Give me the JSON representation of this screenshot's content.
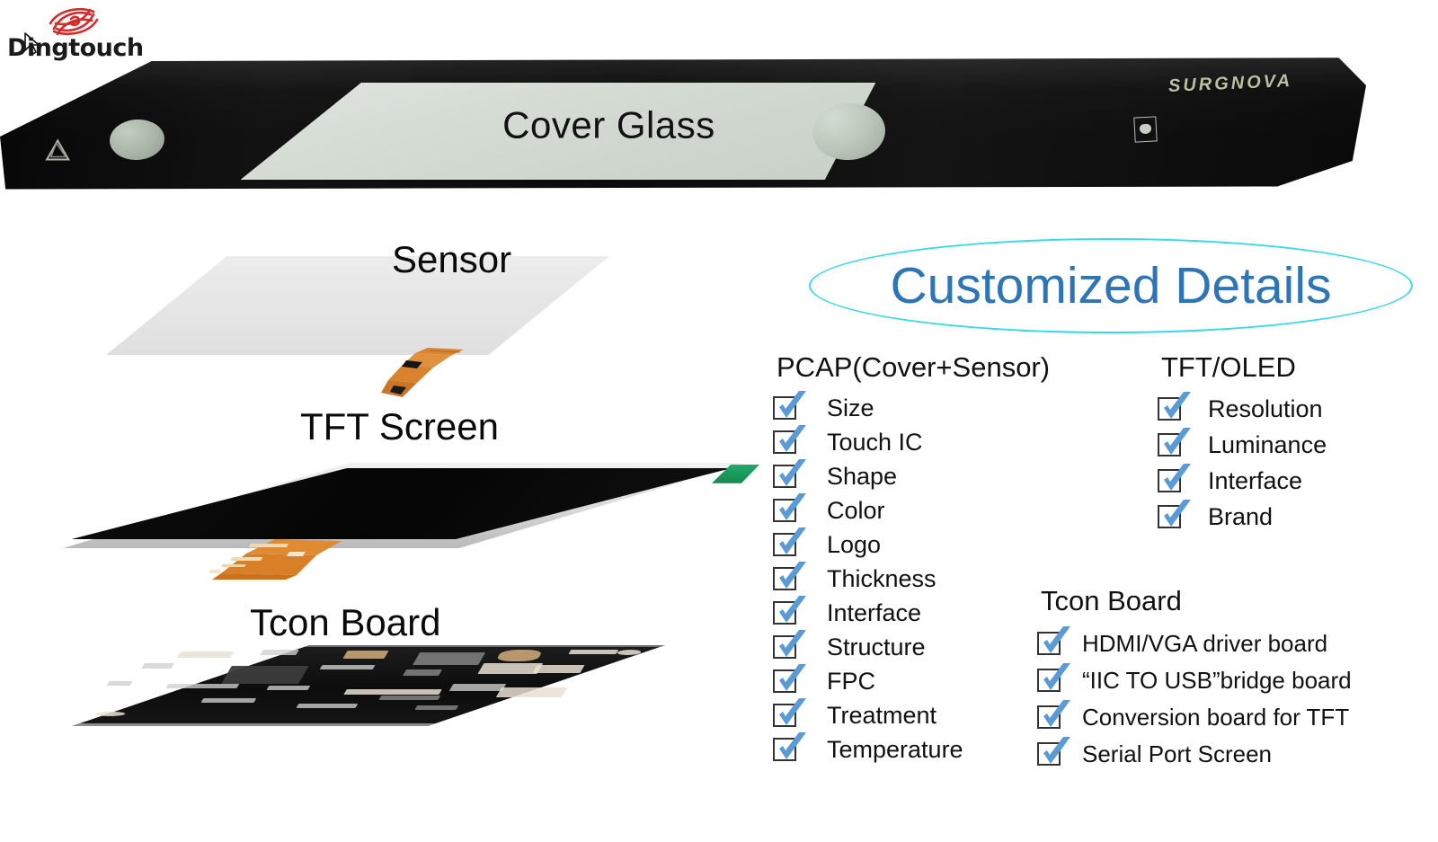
{
  "brand": {
    "name": "Dingtouch",
    "logo_icon": "fingerprint-swirl-icon",
    "logo_color": "#d62b2b"
  },
  "product_photo": {
    "cover_glass_label": "Cover Glass",
    "cover_glass_brand_print": "SURGNOVA"
  },
  "layers": [
    {
      "key": "cover_glass",
      "label": "Cover Glass"
    },
    {
      "key": "sensor",
      "label": "Sensor"
    },
    {
      "key": "tft_screen",
      "label": "TFT Screen"
    },
    {
      "key": "tcon_board",
      "label": "Tcon Board"
    }
  ],
  "layer_labels": {
    "sensor": "Sensor",
    "tft_screen": "TFT Screen",
    "tcon_board": "Tcon Board"
  },
  "details": {
    "title": "Customized Details",
    "title_color": "#2e75b6",
    "ellipse_color": "#38d8ee",
    "check_color": "#5b9bd5",
    "columns": [
      {
        "key": "pcap",
        "heading": "PCAP(Cover+Sensor)",
        "items": [
          {
            "label": "Size",
            "checked": true
          },
          {
            "label": "Touch IC",
            "checked": true
          },
          {
            "label": "Shape",
            "checked": true
          },
          {
            "label": "Color",
            "checked": true
          },
          {
            "label": "Logo",
            "checked": true
          },
          {
            "label": "Thickness",
            "checked": true
          },
          {
            "label": "Interface",
            "checked": true
          },
          {
            "label": "Structure",
            "checked": true
          },
          {
            "label": "FPC",
            "checked": true
          },
          {
            "label": "Treatment",
            "checked": true
          },
          {
            "label": "Temperature",
            "checked": true
          }
        ]
      },
      {
        "key": "tft_oled",
        "heading": "TFT/OLED",
        "items": [
          {
            "label": "Resolution",
            "checked": true
          },
          {
            "label": "Luminance",
            "checked": true
          },
          {
            "label": "Interface",
            "checked": true
          },
          {
            "label": "Brand",
            "checked": true
          }
        ]
      },
      {
        "key": "tcon_board",
        "heading": "Tcon Board",
        "items": [
          {
            "label": "HDMI/VGA driver board",
            "checked": true
          },
          {
            "label": "“IIC TO USB”bridge board",
            "checked": true
          },
          {
            "label": "Conversion board for TFT",
            "checked": true
          },
          {
            "label": "Serial Port Screen",
            "checked": true
          }
        ]
      }
    ]
  }
}
